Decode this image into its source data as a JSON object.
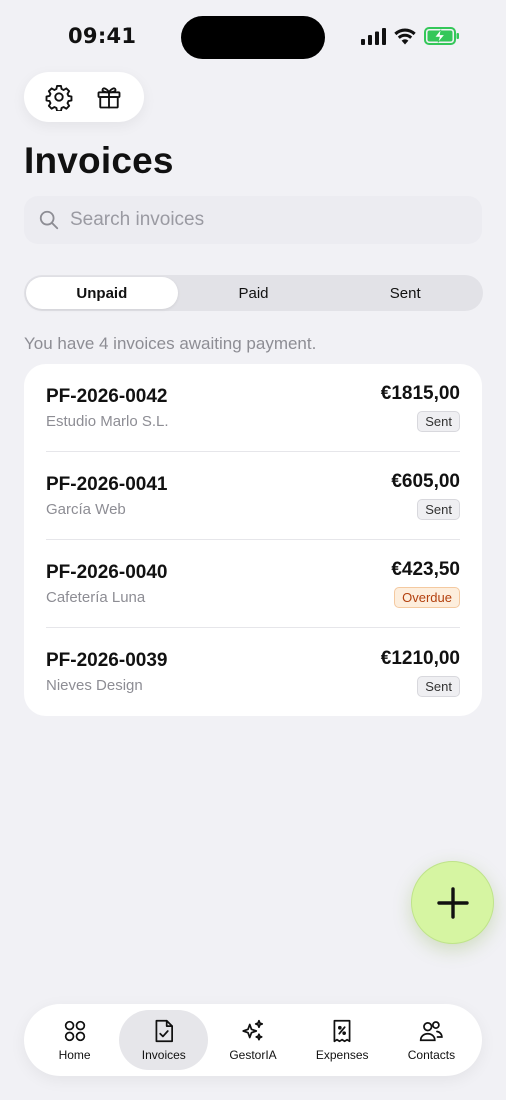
{
  "status_bar": {
    "time": "09:41"
  },
  "header": {
    "title": "Invoices"
  },
  "search": {
    "placeholder": "Search invoices"
  },
  "segments": [
    {
      "label": "Unpaid",
      "active": true
    },
    {
      "label": "Paid",
      "active": false
    },
    {
      "label": "Sent",
      "active": false
    }
  ],
  "summary": "You have 4 invoices awaiting payment.",
  "invoices": [
    {
      "number": "PF-2026-0042",
      "client": "Estudio Marlo S.L.",
      "amount": "€1815,00",
      "status": "Sent"
    },
    {
      "number": "PF-2026-0041",
      "client": "García Web",
      "amount": "€605,00",
      "status": "Sent"
    },
    {
      "number": "PF-2026-0040",
      "client": "Cafetería Luna",
      "amount": "€423,50",
      "status": "Overdue"
    },
    {
      "number": "PF-2026-0039",
      "client": "Nieves Design",
      "amount": "€1210,00",
      "status": "Sent"
    }
  ],
  "tabbar": [
    {
      "label": "Home",
      "icon": "grid-icon"
    },
    {
      "label": "Invoices",
      "icon": "document-check-icon",
      "active": true
    },
    {
      "label": "GestorIA",
      "icon": "sparkles-icon"
    },
    {
      "label": "Expenses",
      "icon": "receipt-percent-icon"
    },
    {
      "label": "Contacts",
      "icon": "users-icon"
    }
  ],
  "colors": {
    "background": "#f1f1f5",
    "fab": "#d6f5a2",
    "overdue_badge": "#fdeedd",
    "overdue_text": "#b3400e",
    "battery": "#34c759"
  }
}
